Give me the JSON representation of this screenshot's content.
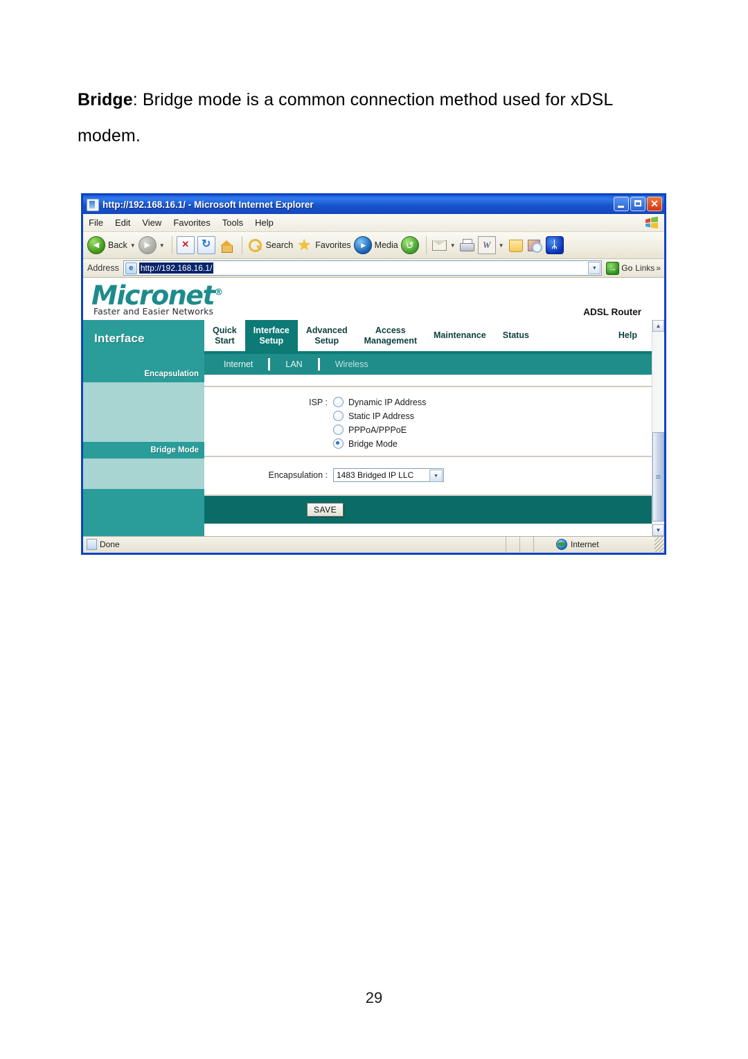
{
  "document": {
    "paragraph_bold": "Bridge",
    "paragraph_rest": ": Bridge mode is a common connection method used for xDSL modem.",
    "page_number": "29"
  },
  "browser": {
    "title": "http://192.168.16.1/ - Microsoft Internet Explorer",
    "window_controls": {
      "minimize": "Minimize",
      "maximize": "Maximize",
      "close": "Close"
    },
    "menu": [
      "File",
      "Edit",
      "View",
      "Favorites",
      "Tools",
      "Help"
    ],
    "toolbar": [
      {
        "icon": "back-icon",
        "label": "Back",
        "has_caret": true
      },
      {
        "icon": "forward-icon",
        "label": "",
        "has_caret": true
      },
      {
        "icon": "stop-icon",
        "label": "",
        "has_caret": false
      },
      {
        "icon": "refresh-icon",
        "label": "",
        "has_caret": false
      },
      {
        "icon": "home-icon",
        "label": "",
        "has_caret": false
      },
      {
        "icon": "search-icon",
        "label": "Search",
        "has_caret": false
      },
      {
        "icon": "favorites-star-icon",
        "label": "Favorites",
        "has_caret": false
      },
      {
        "icon": "media-icon",
        "label": "Media",
        "has_caret": false
      },
      {
        "icon": "history-icon",
        "label": "",
        "has_caret": false
      },
      {
        "icon": "mail-icon",
        "label": "",
        "has_caret": true
      },
      {
        "icon": "print-icon",
        "label": "",
        "has_caret": false
      },
      {
        "icon": "edit-word-icon",
        "label": "",
        "has_caret": true
      },
      {
        "icon": "folder-icon",
        "label": "",
        "has_caret": false
      },
      {
        "icon": "messenger-icon",
        "label": "",
        "has_caret": false
      },
      {
        "icon": "bluetooth-icon",
        "label": "",
        "has_caret": false
      }
    ],
    "address": {
      "label": "Address",
      "value": "http://192.168.16.1/",
      "go_label": "Go",
      "links_label": "Links",
      "overflow_chevrons": "»"
    },
    "statusbar": {
      "text": "Done",
      "zone": "Internet"
    }
  },
  "router": {
    "brand": "Micronet",
    "brand_registered": "®",
    "tagline": "Faster and Easier Networks",
    "model": "ADSL Router",
    "main_tabs": [
      {
        "line1": "Quick",
        "line2": "Start",
        "active": false
      },
      {
        "line1": "Interface",
        "line2": "Setup",
        "active": true
      },
      {
        "line1": "Advanced",
        "line2": "Setup",
        "active": false
      },
      {
        "line1": "Access",
        "line2": "Management",
        "active": false
      },
      {
        "line1": "Maintenance",
        "line2": "",
        "active": false
      },
      {
        "line1": "Status",
        "line2": "",
        "active": false
      },
      {
        "line1": "Help",
        "line2": "",
        "active": false
      }
    ],
    "sub_tabs": [
      {
        "label": "Internet",
        "active": true
      },
      {
        "label": "LAN",
        "active": false
      },
      {
        "label": "Wireless",
        "active": false
      }
    ],
    "sidebar": {
      "title": "Interface",
      "sections": [
        "Encapsulation",
        "Bridge Mode"
      ]
    },
    "form": {
      "isp_label": "ISP :",
      "isp_options": [
        {
          "label": "Dynamic IP Address",
          "selected": false
        },
        {
          "label": "Static IP Address",
          "selected": false
        },
        {
          "label": "PPPoA/PPPoE",
          "selected": false
        },
        {
          "label": "Bridge Mode",
          "selected": true
        }
      ],
      "encapsulation_label": "Encapsulation :",
      "encapsulation_value": "1483 Bridged IP LLC",
      "save_label": "SAVE"
    }
  },
  "colors": {
    "teal": "#2a9d9a",
    "teal_dark": "#0e7a75",
    "teal_darker": "#0b6b66",
    "teal_light": "#a8d5d2",
    "brand": "#1d8b8b",
    "title_blue": "#0b43c4"
  }
}
